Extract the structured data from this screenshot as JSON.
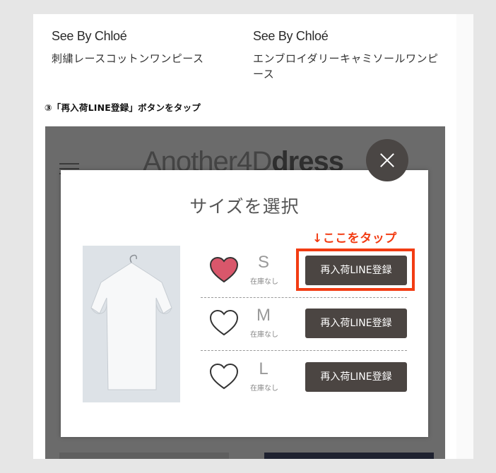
{
  "products": [
    {
      "brand": "See By Chloé",
      "name": "刺繍レースコットンワンピース"
    },
    {
      "brand": "See By Chloé",
      "name": "エンブロイダリーキャミソールワンピース"
    }
  ],
  "instruction": "③「再入荷LINE登録」ボタンをタップ",
  "screenshot": {
    "logo_thin": "Another4D",
    "logo_bold": "dress",
    "modal": {
      "title": "サイズを選択",
      "tap_note": "↓ここをタップ",
      "sizes": [
        {
          "size": "S",
          "stock": "在庫なし",
          "button": "再入荷LINE登録",
          "favorited": true
        },
        {
          "size": "M",
          "stock": "在庫なし",
          "button": "再入荷LINE登録",
          "favorited": false
        },
        {
          "size": "L",
          "stock": "在庫なし",
          "button": "再入荷LINE登録",
          "favorited": false
        }
      ]
    }
  },
  "colors": {
    "highlight": "#f23c13",
    "heart_filled": "#d9576b",
    "button_bg": "#4b4542",
    "close_button_bg": "#4a4644"
  }
}
